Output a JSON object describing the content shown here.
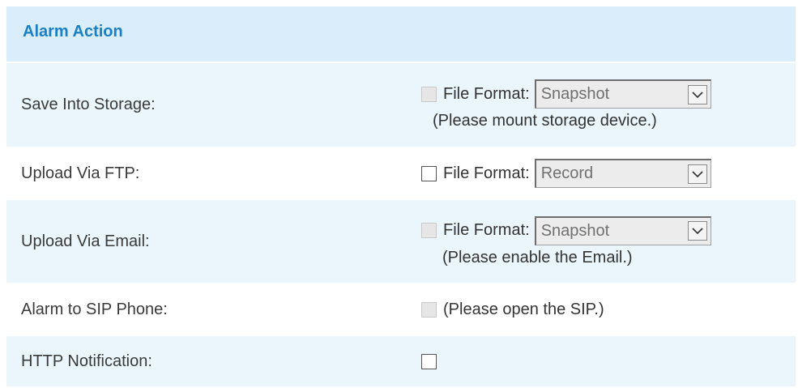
{
  "section": {
    "title": "Alarm Action"
  },
  "rows": [
    {
      "label": "Save Into Storage:",
      "checkbox_enabled": false,
      "file_format_label": "File Format:",
      "select_value": "Snapshot",
      "hint": "(Please mount storage device.)"
    },
    {
      "label": "Upload Via FTP:",
      "checkbox_enabled": true,
      "file_format_label": "File Format:",
      "select_value": "Record"
    },
    {
      "label": "Upload Via Email:",
      "checkbox_enabled": false,
      "file_format_label": "File Format:",
      "select_value": "Snapshot",
      "hint": "(Please enable the Email.)"
    },
    {
      "label": "Alarm to SIP Phone:",
      "checkbox_enabled": false,
      "hint": "(Please open the SIP.)"
    },
    {
      "label": "HTTP Notification:",
      "checkbox_enabled": true
    }
  ],
  "icons": {
    "select_arrow": "chevron-down-icon"
  }
}
